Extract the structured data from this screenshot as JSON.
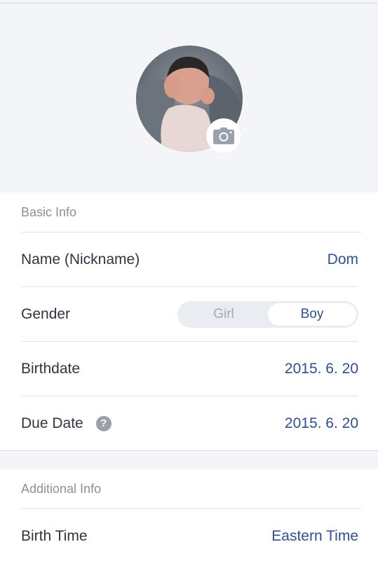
{
  "profile": {
    "photo_alt": "Baby profile photo"
  },
  "basic_info": {
    "header": "Basic Info",
    "name_label": "Name (Nickname)",
    "name_value": "Dom",
    "gender_label": "Gender",
    "gender_options": [
      "Girl",
      "Boy"
    ],
    "gender_selected": "Boy",
    "birthdate_label": "Birthdate",
    "birthdate_value": "2015. 6. 20",
    "due_date_label": "Due Date",
    "due_date_value": "2015. 6. 20",
    "help_icon_glyph": "?"
  },
  "additional_info": {
    "header": "Additional Info",
    "birth_time_label": "Birth Time",
    "birth_time_value": "Eastern Time"
  },
  "colors": {
    "accent": "#2f4f8f",
    "background": "#f3f5f8",
    "muted_text": "#8a9099"
  },
  "icons": {
    "camera": "camera-icon",
    "help": "question-circle-icon"
  }
}
